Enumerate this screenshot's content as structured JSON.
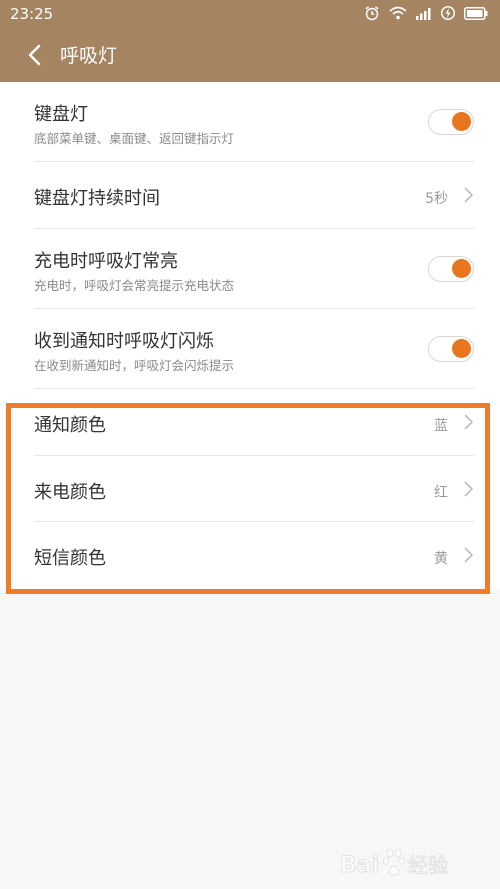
{
  "status": {
    "time": "23:25",
    "icons": [
      "alarm-icon",
      "wifi-icon",
      "signal-icon",
      "battery-charging-icon"
    ]
  },
  "header": {
    "title": "呼吸灯",
    "back_icon": "chevron-left-icon"
  },
  "settings": [
    {
      "title": "键盘灯",
      "subtitle": "底部菜单键、桌面键、返回键指示灯",
      "type": "toggle",
      "on": true
    },
    {
      "title": "键盘灯持续时间",
      "type": "value",
      "value": "5秒"
    },
    {
      "title": "充电时呼吸灯常亮",
      "subtitle": "充电时，呼吸灯会常亮提示充电状态",
      "type": "toggle",
      "on": true
    },
    {
      "title": "收到通知时呼吸灯闪烁",
      "subtitle": "在收到新通知时，呼吸灯会闪烁提示",
      "type": "toggle",
      "on": true
    },
    {
      "title": "通知颜色",
      "type": "value",
      "value": "蓝"
    },
    {
      "title": "来电颜色",
      "type": "value",
      "value": "红"
    },
    {
      "title": "短信颜色",
      "type": "value",
      "value": "黄"
    }
  ],
  "watermark": "Baidu 经验",
  "colors": {
    "header_bg": "#a58462",
    "toggle_knob": "#e8761e",
    "highlight_border": "#f27b29",
    "page_bg": "#f7f7f7"
  }
}
